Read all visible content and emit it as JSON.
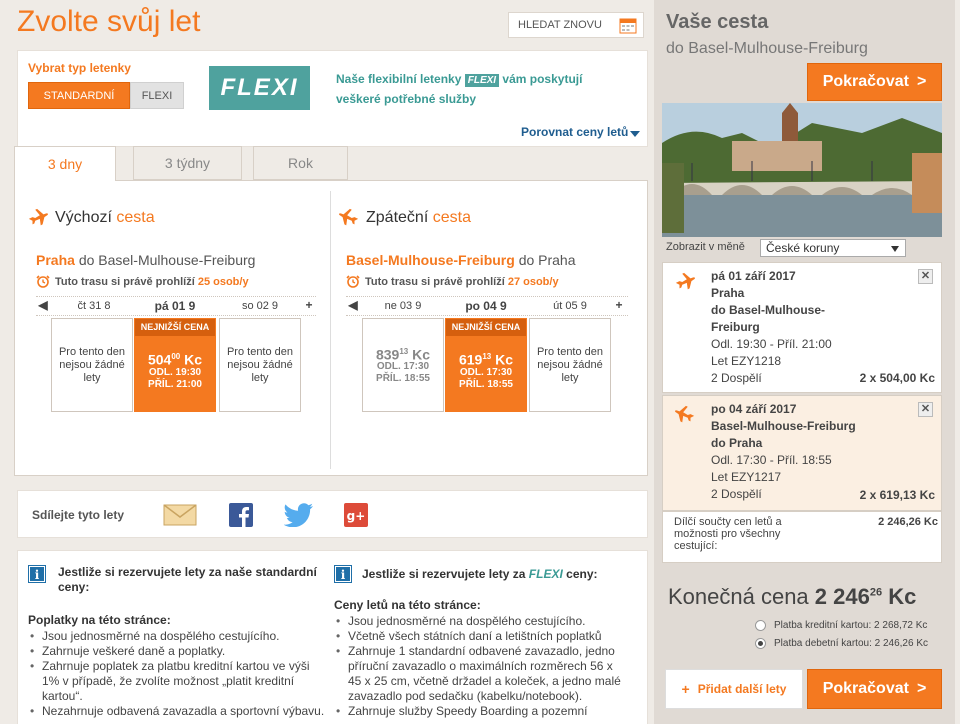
{
  "header": {
    "title": "Zvolte svůj let",
    "search_again": "HLEDAT ZNOVU"
  },
  "ticket_type": {
    "label": "Vybrat typ letenky",
    "standard": "STANDARDNÍ",
    "flexi": "FLEXI",
    "logo": "FLEXI",
    "promo_a": "Naše flexibilní letenky",
    "promo_badge": "FLEXI",
    "promo_b": "vám poskytují",
    "promo_c": "veškeré potřebné služby",
    "compare": "Porovnat ceny letů"
  },
  "tabs": [
    {
      "label": "3 dny"
    },
    {
      "label": "3 týdny"
    },
    {
      "label": "Rok"
    }
  ],
  "outbound": {
    "h1": "Výchozí",
    "h2": "cesta",
    "from": "Praha",
    "route_rest": "do Basel-Mulhouse-Freiburg",
    "viewers_a": "Tuto trasu si právě prohlíží",
    "viewers_b": "25 osob/y",
    "days": [
      "čt 31 8",
      "pá 01 9",
      "so 02 9"
    ],
    "none_text": "Pro tento den nejsou žádné lety",
    "tag": "NEJNIŽŠÍ CENA",
    "price_main": "504",
    "price_sup": "00",
    "price_cur": "Kc",
    "dep": "ODL. 19:30",
    "arr": "PŘÍL. 21:00"
  },
  "inbound": {
    "h1": "Zpáteční",
    "h2": "cesta",
    "from": "Basel-Mulhouse-Freiburg",
    "route_rest": "do Praha",
    "viewers_a": "Tuto trasu si právě prohlíží",
    "viewers_b": "27 osob/y",
    "days": [
      "ne 03 9",
      "po 04 9",
      "út 05 9"
    ],
    "none_text": "Pro tento den nejsou žádné lety",
    "alt_price_main": "839",
    "alt_price_sup": "13",
    "alt_price_cur": "Kc",
    "alt_dep": "ODL. 17:30",
    "alt_arr": "PŘÍL. 18:55",
    "tag": "NEJNIŽŠÍ CENA",
    "price_main": "619",
    "price_sup": "13",
    "price_cur": "Kc",
    "dep": "ODL. 17:30",
    "arr": "PŘÍL. 18:55"
  },
  "share": {
    "label": "Sdílejte tyto lety"
  },
  "info_std": {
    "title": "Jestliže si rezervujete lety za naše standardní ceny:",
    "subtitle": "Poplatky na této stránce:",
    "items": [
      "Jsou jednosměrné na dospělého cestujícího.",
      "Zahrnuje veškeré daně a poplatky.",
      "Zahrnuje poplatek za platbu kreditní kartou ve výši 1% v případě, že zvolíte možnost „platit kreditní kartou“.",
      "Nezahrnuje odbavená zavazadla a sportovní výbavu."
    ]
  },
  "info_flexi": {
    "title_a": "Jestliže si rezervujete lety za",
    "title_badge": "FLEXI",
    "title_b": "ceny:",
    "subtitle": "Ceny letů na této stránce:",
    "items": [
      "Jsou jednosměrné na dospělého cestujícího.",
      "Včetně všech státních daní a letištních poplatků",
      "Zahrnuje 1 standardní odbavené zavazadlo, jedno příruční zavazadlo o maximálních rozměrech 56 x 45 x 25 cm, včetně držadel a koleček, a jedno malé zavazadlo pod sedačku (kabelku/notebook).",
      "Zahrnuje služby Speedy Boarding a pozemní"
    ]
  },
  "sidebar": {
    "title": "Vaše cesta",
    "subtitle": "do Basel-Mulhouse-Freiburg",
    "continue": "Pokračovat",
    "currency_label": "Zobrazit v měně",
    "currency_value": "České koruny",
    "legs": [
      {
        "date": "pá 01 září 2017",
        "from": "Praha",
        "to_a": "do Basel-Mulhouse-",
        "to_b": "Freiburg",
        "times": "Odl. 19:30 - Příl. 21:00",
        "flight": "Let EZY1218",
        "pax": "2 Dospělí",
        "price": "2 x 504,00 Kc"
      },
      {
        "date": "po 04 září 2017",
        "from": "Basel-Mulhouse-Freiburg",
        "to_a": "do Praha",
        "to_b": "",
        "times": "Odl. 17:30 - Příl. 18:55",
        "flight": "Let EZY1217",
        "pax": "2 Dospělí",
        "price": "2 x 619,13 Kc"
      }
    ],
    "subtotal_label": "Dílčí součty cen letů a možnosti pro všechny cestující:",
    "subtotal_value": "2 246,26 Kc",
    "final_label": "Konečná cena",
    "final_main": "2 246",
    "final_sup": "26",
    "final_cur": "Kc",
    "pay_credit": "Platba kreditní kartou: 2 268,72 Kc",
    "pay_debit": "Platba debetní kartou: 2 246,26 Kc",
    "add_flights": "Přidat další lety",
    "continue2": "Pokračovat"
  }
}
